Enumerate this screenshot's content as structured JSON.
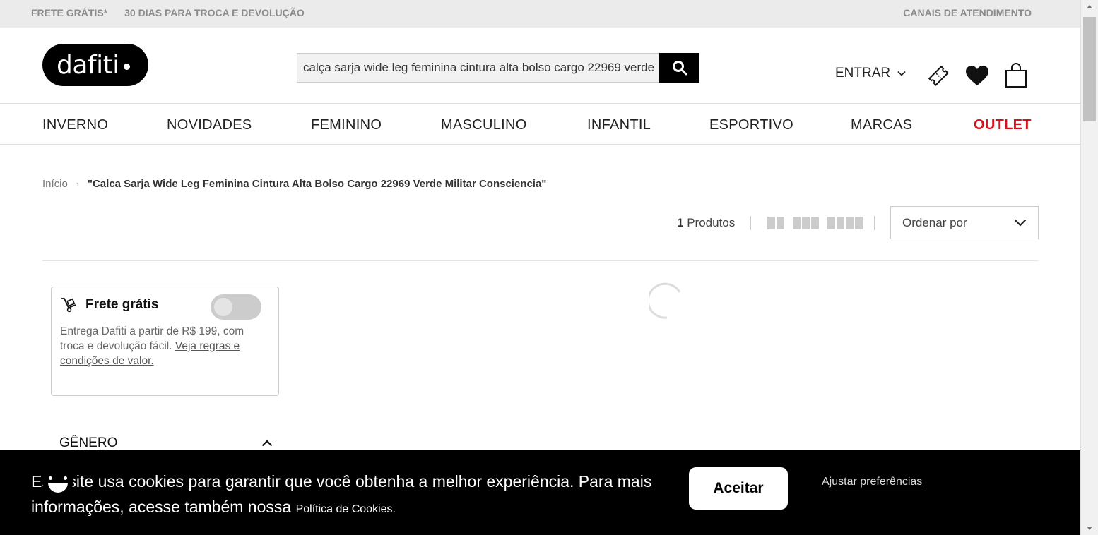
{
  "topbar": {
    "free_shipping": "FRETE GRÁTIS*",
    "returns": "30 DIAS PARA TROCA E DEVOLUÇÃO",
    "support": "CANAIS DE ATENDIMENTO"
  },
  "header": {
    "logo_text": "dafiti",
    "search_value": "calça sarja wide leg feminina cintura alta bolso cargo 22969 verde militar consciencia",
    "login_label": "ENTRAR",
    "icons": [
      "search-icon",
      "coupon-icon",
      "heart-icon",
      "bag-icon",
      "chevron-down-icon"
    ]
  },
  "nav": {
    "items": [
      "INVERNO",
      "NOVIDADES",
      "FEMININO",
      "MASCULINO",
      "INFANTIL",
      "ESPORTIVO",
      "MARCAS"
    ],
    "outlet": "OUTLET",
    "outlet_color": "#d3121c"
  },
  "breadcrumb": {
    "home": "Início",
    "separator": "›",
    "current": "\"Calca Sarja Wide Leg Feminina Cintura Alta Bolso Cargo 22969 Verde Militar Consciencia\""
  },
  "results": {
    "count": "1",
    "count_label": "Produtos",
    "sort_label": "Ordenar por"
  },
  "free_shipping_filter": {
    "title": "Frete grátis",
    "enabled": false,
    "description": "Entrega Dafiti a partir de R$ 199, com troca e devolução fácil. ",
    "link": "Veja regras e condições de valor."
  },
  "filters": {
    "gender_title": "GÊNERO"
  },
  "cookie_banner": {
    "text_prefix": "Este site usa cookies para garantir que você obtenha a melhor experiência. Para mais informações, acesse também nossa ",
    "policy_link": "Política de Cookies.",
    "accept_label": "Aceitar",
    "preferences_label": "Ajustar preferências"
  }
}
